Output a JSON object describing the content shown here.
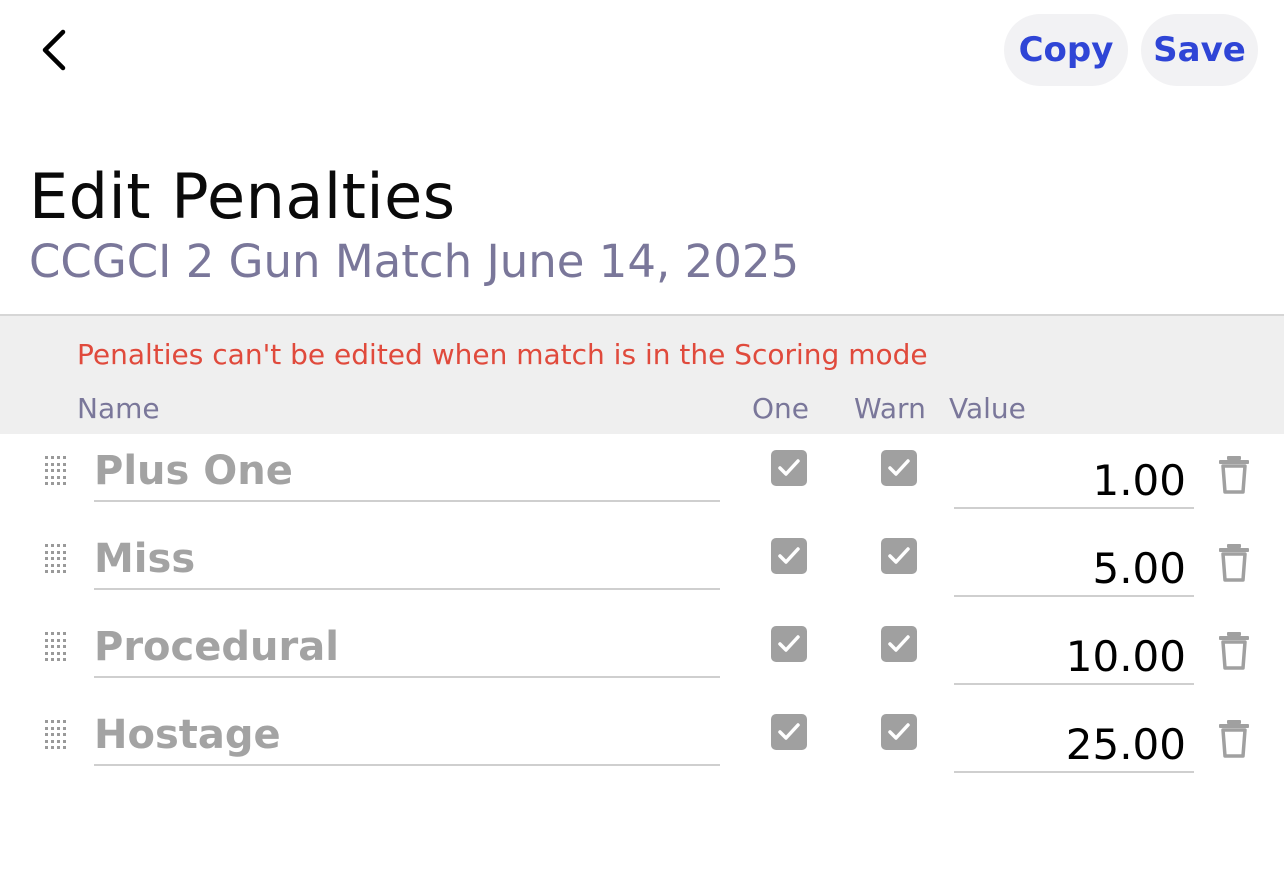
{
  "header": {
    "back_icon": "chevron-left-icon",
    "copy_label": "Copy",
    "save_label": "Save",
    "accent_color": "#2f45d6"
  },
  "page": {
    "title": "Edit Penalties",
    "subtitle": "CCGCI 2 Gun Match June 14, 2025"
  },
  "table": {
    "warning": "Penalties can't be edited when match is in the Scoring mode",
    "warning_color": "#e04a3c",
    "columns": {
      "name": "Name",
      "one": "One",
      "warn": "Warn",
      "value": "Value"
    },
    "rows": [
      {
        "name": "Plus One",
        "one": true,
        "warn": true,
        "value": "1.00"
      },
      {
        "name": "Miss",
        "one": true,
        "warn": true,
        "value": "5.00"
      },
      {
        "name": "Procedural",
        "one": true,
        "warn": true,
        "value": "10.00"
      },
      {
        "name": "Hostage",
        "one": true,
        "warn": true,
        "value": "25.00"
      }
    ],
    "row_icons": {
      "drag": "drag-handle-icon",
      "delete": "trash-icon",
      "check": "checkmark-icon"
    }
  }
}
